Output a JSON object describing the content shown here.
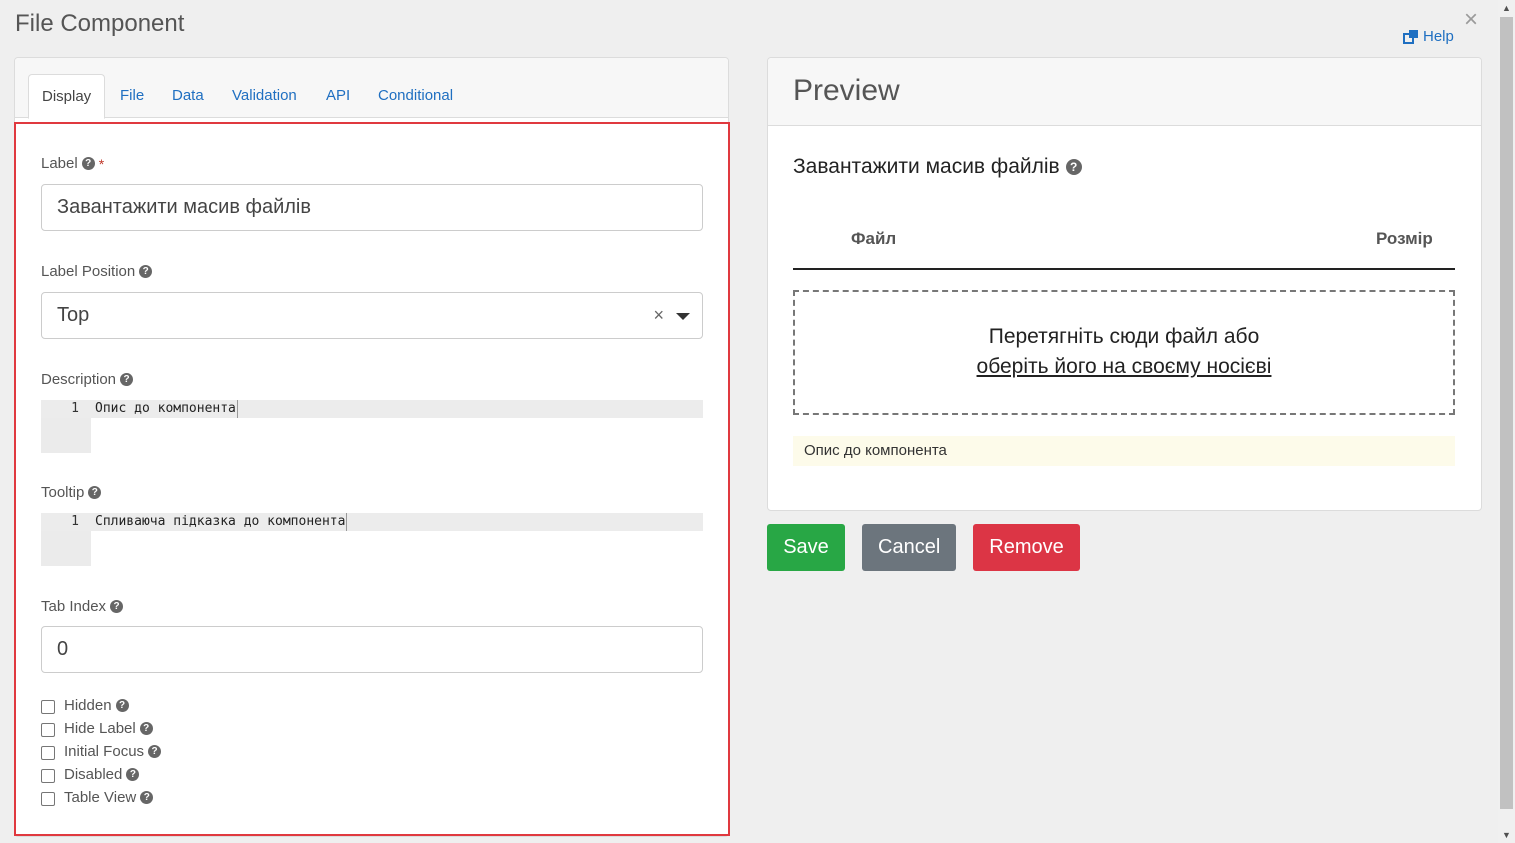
{
  "modal": {
    "title": "File Component",
    "close_glyph": "×",
    "help_label": "Help"
  },
  "tabs": [
    {
      "label": "Display",
      "active": true
    },
    {
      "label": "File",
      "active": false
    },
    {
      "label": "Data",
      "active": false
    },
    {
      "label": "Validation",
      "active": false
    },
    {
      "label": "API",
      "active": false
    },
    {
      "label": "Conditional",
      "active": false
    }
  ],
  "form": {
    "label": {
      "title": "Label",
      "required_mark": "*",
      "value": "Завантажити масив файлів"
    },
    "label_position": {
      "title": "Label Position",
      "value": "Top",
      "clear_glyph": "×"
    },
    "description": {
      "title": "Description",
      "line_number": "1",
      "value": "Опис до компонента"
    },
    "tooltip": {
      "title": "Tooltip",
      "line_number": "1",
      "value": "Спливаюча підказка до компонента"
    },
    "tab_index": {
      "title": "Tab Index",
      "value": "0"
    },
    "checkboxes": [
      {
        "label": "Hidden",
        "checked": false
      },
      {
        "label": "Hide Label",
        "checked": false
      },
      {
        "label": "Initial Focus",
        "checked": false
      },
      {
        "label": "Disabled",
        "checked": false
      },
      {
        "label": "Table View",
        "checked": false
      }
    ]
  },
  "preview": {
    "title": "Preview",
    "component_label": "Завантажити масив файлів",
    "columns": [
      "Файл",
      "Розмір"
    ],
    "dropzone_text": "Перетягніть сюди файл або",
    "dropzone_link": "оберіть його на своєму носієві",
    "description": "Опис до компонента"
  },
  "buttons": {
    "save": "Save",
    "cancel": "Cancel",
    "remove": "Remove"
  },
  "colors": {
    "accent_link": "#1f6fc1",
    "highlight_border": "#e0393f",
    "save": "#28a745",
    "cancel": "#6c757d",
    "remove": "#dc3545"
  }
}
